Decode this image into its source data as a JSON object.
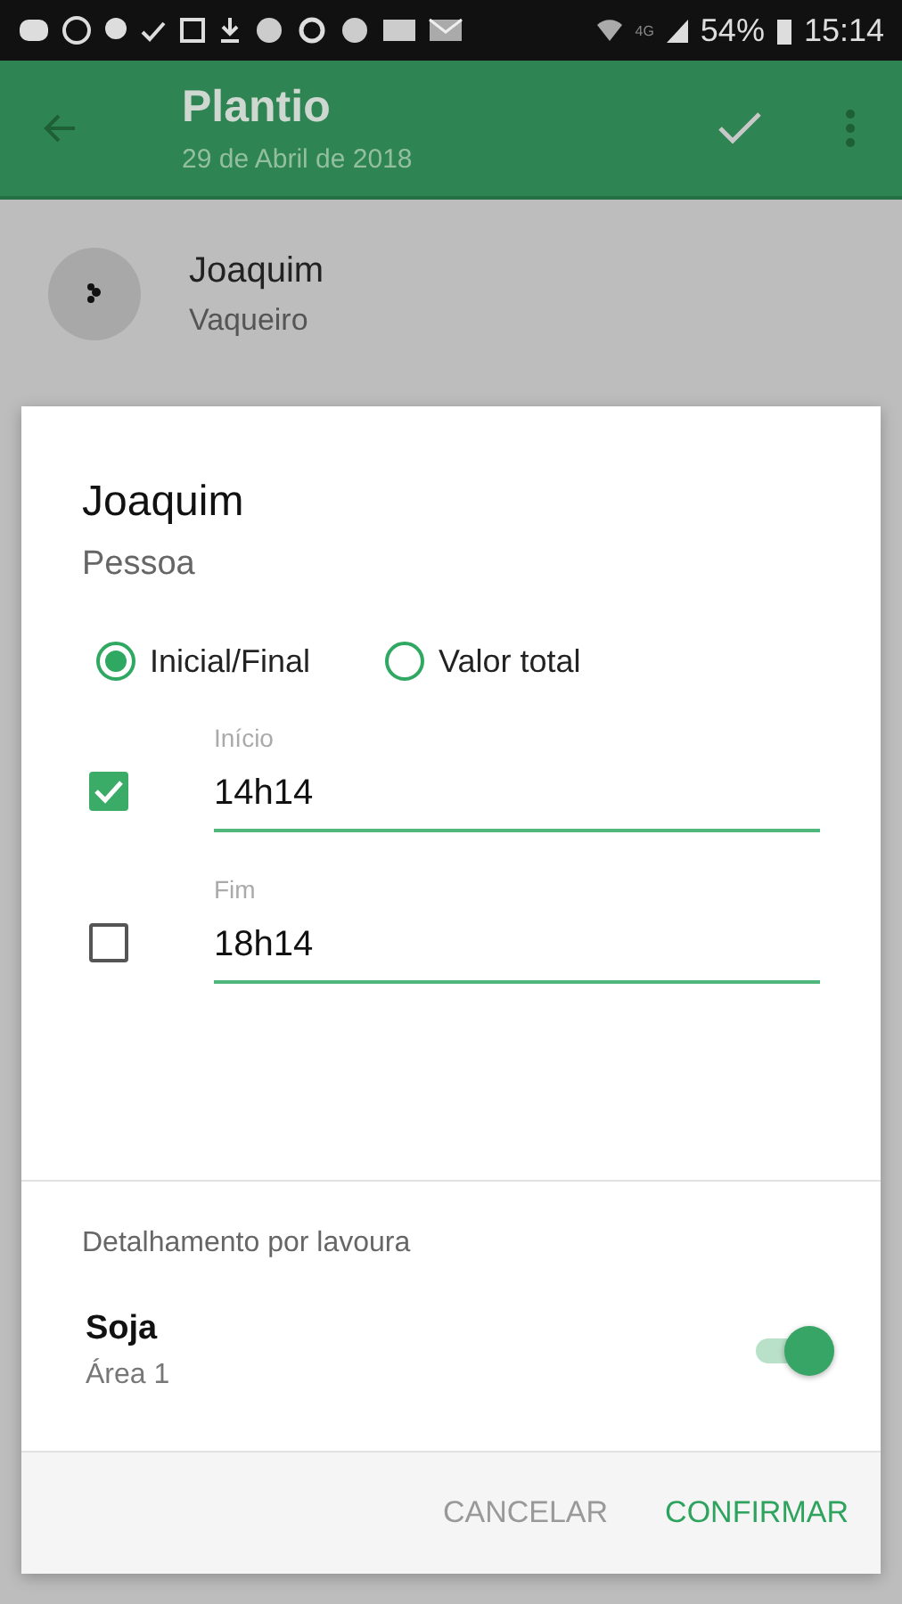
{
  "status_bar": {
    "network": "4G",
    "battery": "54%",
    "time": "15:14"
  },
  "app_bar": {
    "title": "Plantio",
    "subtitle": "29 de Abril de 2018"
  },
  "contact": {
    "name": "Joaquim",
    "role": "Vaqueiro"
  },
  "dialog": {
    "title": "Joaquim",
    "subtitle": "Pessoa",
    "options": [
      {
        "label": "Inicial/Final",
        "selected": true
      },
      {
        "label": "Valor total",
        "selected": false
      }
    ],
    "fields": [
      {
        "label": "Início",
        "value": "14h14",
        "checked": true
      },
      {
        "label": "Fim",
        "value": "18h14",
        "checked": false
      }
    ],
    "section_title": "Detalhamento por lavoura",
    "crops": [
      {
        "name": "Soja",
        "area": "Área 1",
        "on": true
      }
    ],
    "buttons": [
      {
        "label": "CANCELAR",
        "kind": "neutral"
      },
      {
        "label": "CONFIRMAR",
        "kind": "primary"
      }
    ]
  }
}
